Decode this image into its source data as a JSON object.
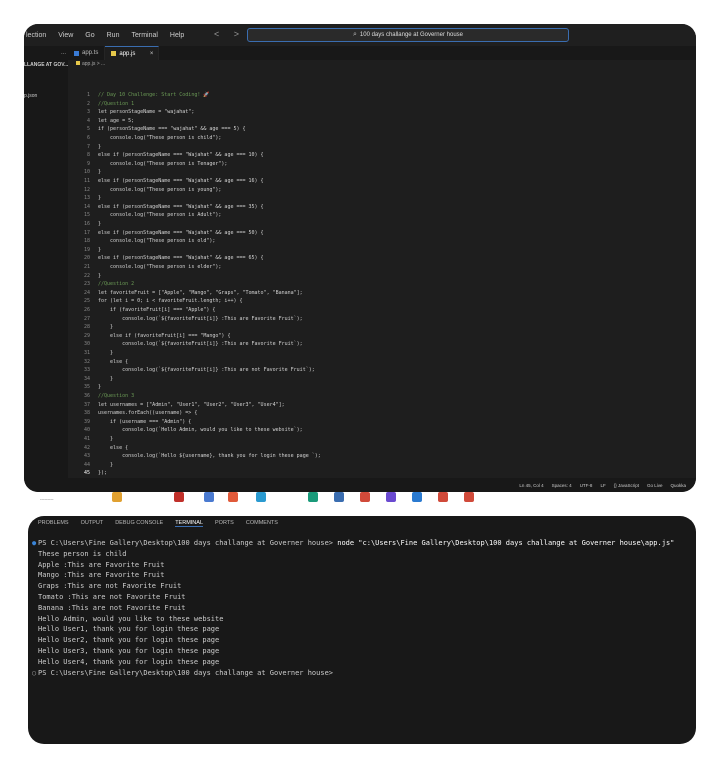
{
  "menubar": {
    "items": [
      "lection",
      "View",
      "Go",
      "Run",
      "Terminal",
      "Help"
    ],
    "nav_arrows": "< >",
    "search_text": "100 days challange at Governer house"
  },
  "explorer": {
    "dots": "...",
    "folder_label": "LLANGE AT GOV...",
    "file_label": "p.json"
  },
  "tabs": [
    {
      "label": "app.ts",
      "active": false
    },
    {
      "label": "app.js",
      "active": true,
      "close": "×"
    }
  ],
  "breadcrumb": "app.js > ...",
  "code": {
    "lines": [
      "// Day 10 Challenge: Start Coding! 🚀",
      "//Question 1",
      "let personStageName = \"wajahat\";",
      "let age = 5;",
      "if (personStageName === \"wajahat\" && age === 5) {",
      "    console.log(\"These person is child\");",
      "}",
      "else if (personStageName === \"Wajahat\" && age === 10) {",
      "    console.log(\"These person is Tenager\");",
      "}",
      "else if (personStageName === \"Wajahat\" && age === 16) {",
      "    console.log(\"These person is young\");",
      "}",
      "else if (personStageName === \"Wajahat\" && age === 35) {",
      "    console.log(\"These person is Adult\");",
      "}",
      "else if (personStageName === \"Wajahat\" && age === 50) {",
      "    console.log(\"These person is old\");",
      "}",
      "else if (personStageName === \"Wajahat\" && age === 65) {",
      "    console.log(\"These person is elder\");",
      "}",
      "//Question 2",
      "let favoriteFruit = [\"Apple\", \"Mango\", \"Graps\", \"Tomato\", \"Banana\"];",
      "for (let i = 0; i < favoriteFruit.length; i++) {",
      "    if (favoriteFruit[i] === \"Apple\") {",
      "        console.log(`${favoriteFruit[i]} :This are Favorite Fruit`);",
      "    }",
      "    else if (favoriteFruit[i] === \"Mango\") {",
      "        console.log(`${favoriteFruit[i]} :This are Favorite Fruit`);",
      "    }",
      "    else {",
      "        console.log(`${favoriteFruit[i]} :This are not Favorite Fruit`);",
      "    }",
      "}",
      "//Question 3",
      "let usernames = [\"Admin\", \"User1\", \"User2\", \"User3\", \"User4\"];",
      "usernames.forEach((username) => {",
      "    if (username === \"Admin\") {",
      "        console.log(`Hello Admin, would you like to these website`);",
      "    }",
      "    else {",
      "        console.log(`Hello ${username}, thank you for login these page `);",
      "    }",
      "});"
    ]
  },
  "statusbar": {
    "items": [
      "Ln 45, Col 4",
      "Spaces: 4",
      "UTF-8",
      "LF",
      "{} JavaScript",
      "Go Live",
      "Quokka"
    ]
  },
  "taskbar": {
    "label": "---------"
  },
  "terminal": {
    "tabs": [
      "PROBLEMS",
      "OUTPUT",
      "DEBUG CONSOLE",
      "TERMINAL",
      "PORTS",
      "COMMENTS"
    ],
    "active_tab": "TERMINAL",
    "prompt": "PS C:\\Users\\Fine Gallery\\Desktop\\100 days challange at Governer house> ",
    "command": "node \"c:\\Users\\Fine Gallery\\Desktop\\100 days challange at Governer house\\app.js\"",
    "output": [
      "These person is child",
      "Apple :This are Favorite Fruit",
      "Mango :This are Favorite Fruit",
      "Graps :This are not Favorite Fruit",
      "Tomato :This are not Favorite Fruit",
      "Banana :This are not Favorite Fruit",
      "Hello Admin, would you like to these website",
      "Hello User1, thank you for login these page",
      "Hello User2, thank you for login these page",
      "Hello User3, thank you for login these page",
      "Hello User4, thank you for login these page"
    ],
    "final_prompt": "PS C:\\Users\\Fine Gallery\\Desktop\\100 days challange at Governer house>"
  },
  "colors": {
    "editor_bg": "#1e1e1e",
    "accent": "#3a6db0",
    "keyword": "#569cd6",
    "string": "#ce9178",
    "comment": "#6a9955"
  }
}
